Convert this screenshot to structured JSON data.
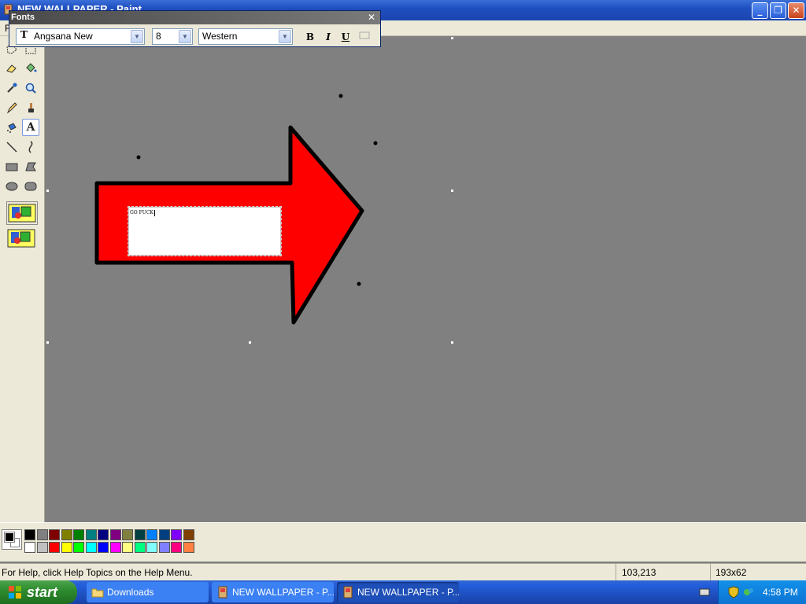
{
  "window": {
    "title": "NEW WALLPAPER - Paint",
    "buttons": {
      "minimize": "_",
      "restore": "❐",
      "close": "✕"
    }
  },
  "menu": {
    "first": "F"
  },
  "fonts_toolbar": {
    "title": "Fonts",
    "close": "✕",
    "font_name": "Angsana New",
    "font_size": "8",
    "script": "Western",
    "bold": "B",
    "italic": "I",
    "underline": "U"
  },
  "canvas": {
    "textbox_text": "GO FUCK",
    "colors": {
      "background": "#808080",
      "arrow_fill": "#ff0000",
      "arrow_outline": "#000000"
    }
  },
  "palette": {
    "foreground": "#000000",
    "background": "#ffffff",
    "row1": [
      "#000000",
      "#808080",
      "#800000",
      "#808000",
      "#008000",
      "#008080",
      "#000080",
      "#800080",
      "#808040",
      "#004040",
      "#0080ff",
      "#004080",
      "#8000ff",
      "#804000"
    ],
    "row2": [
      "#ffffff",
      "#c0c0c0",
      "#ff0000",
      "#ffff00",
      "#00ff00",
      "#00ffff",
      "#0000ff",
      "#ff00ff",
      "#ffff80",
      "#00ff80",
      "#80ffff",
      "#8080ff",
      "#ff0080",
      "#ff8040"
    ]
  },
  "status": {
    "help": "For Help, click Help Topics on the Help Menu.",
    "coords": "103,213",
    "size": "193x62"
  },
  "taskbar": {
    "start": "start",
    "items": [
      "Downloads",
      "NEW WALLPAPER - P...",
      "NEW WALLPAPER - P..."
    ],
    "clock": "4:58 PM"
  }
}
